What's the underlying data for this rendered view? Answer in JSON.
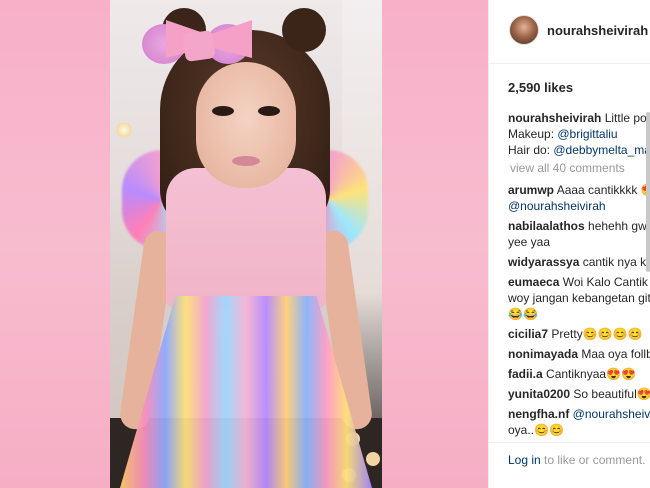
{
  "post": {
    "username": "nourahsheivirah",
    "likes": "2,590 likes",
    "caption": {
      "username": "nourahsheivirah",
      "text": "Little pon",
      "makeup_label": "Makeup:",
      "makeup_handle": "@brigittaliu",
      "hair_label": "Hair do:",
      "hair_handle": "@debbymelta_mal"
    },
    "view_all": "view all 40 comments",
    "comments": [
      {
        "user": "arumwp",
        "lines": [
          "Aaaa cantikkkk 😍",
          "@nourahsheivirah"
        ]
      },
      {
        "user": "nabilaalathos",
        "lines": [
          "hehehh gw c",
          "yee yaa"
        ]
      },
      {
        "user": "widyarassya",
        "lines": [
          "cantik nya ka"
        ]
      },
      {
        "user": "eumaeca",
        "lines": [
          "Woi Kalo Cantik b",
          "woy jangan kebangetan git",
          "😂😂"
        ]
      },
      {
        "user": "cicilia7",
        "lines": [
          "Pretty😊😊😊😊"
        ]
      },
      {
        "user": "nonimayada",
        "lines": [
          "Maa oya follb"
        ]
      },
      {
        "user": "fadii.a",
        "lines": [
          "Cantiknyaa😍😍"
        ]
      },
      {
        "user": "yunita0200",
        "lines": [
          "So beautiful😍"
        ]
      },
      {
        "user": "nengfha.nf",
        "lines": [
          "@nourahsheivir",
          "oya..😊😊"
        ]
      }
    ],
    "login": {
      "link": "Log in",
      "rest": " to like or comment."
    }
  }
}
